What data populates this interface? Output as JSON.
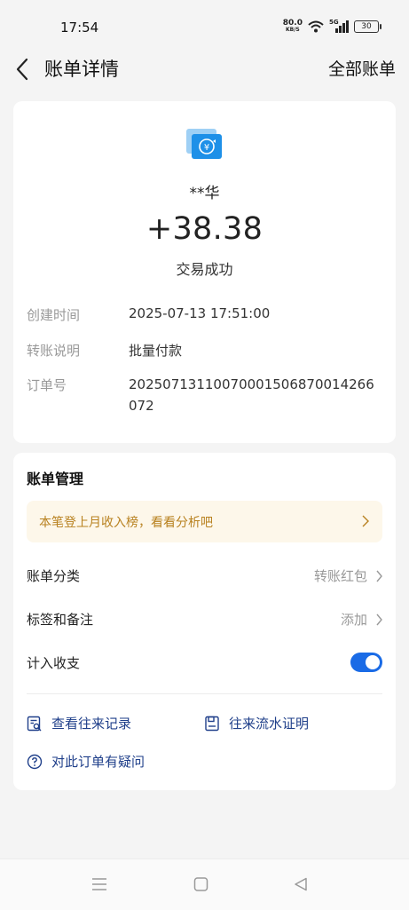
{
  "status_bar": {
    "time": "17:54",
    "net_speed": "80.0",
    "net_unit": "KB/S",
    "network_type": "5G",
    "battery": "30"
  },
  "nav": {
    "title": "账单详情",
    "all_bills": "全部账单"
  },
  "transaction": {
    "icon": "transfer-yuan-icon",
    "payee": "**华",
    "amount": "+38.38",
    "status": "交易成功",
    "details": [
      {
        "label": "创建时间",
        "value": "2025-07-13 17:51:00"
      },
      {
        "label": "转账说明",
        "value": "批量付款"
      },
      {
        "label": "订单号",
        "value": "20250713110070001506870014266072"
      }
    ]
  },
  "manage": {
    "title": "账单管理",
    "promo": "本笔登上月收入榜，看看分析吧",
    "category_label": "账单分类",
    "category_value": "转账红包",
    "tags_label": "标签和备注",
    "tags_value": "添加",
    "include_label": "计入收支",
    "include_enabled": true,
    "links": {
      "history": "查看往来记录",
      "statement": "往来流水证明",
      "question": "对此订单有疑问"
    }
  },
  "colors": {
    "accent": "#1a6be6",
    "link": "#1f3f8a",
    "promo_bg": "#fdf7ea",
    "promo_text": "#b8811f",
    "muted": "#999999"
  }
}
